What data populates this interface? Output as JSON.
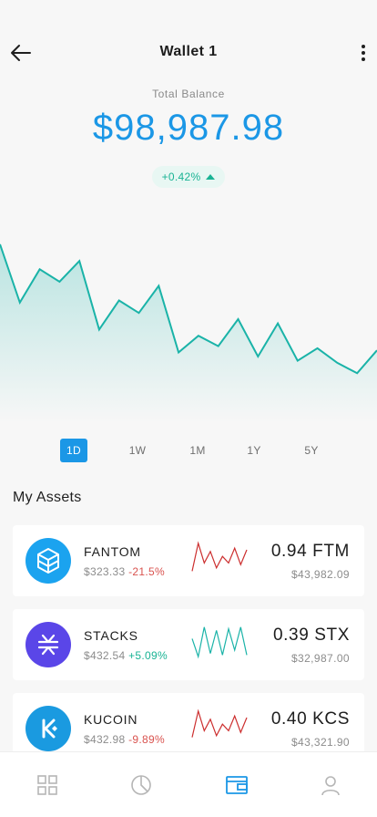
{
  "header": {
    "title": "Wallet 1",
    "back_icon": "arrow-left-icon",
    "menu_icon": "more-vertical-icon"
  },
  "balance": {
    "label": "Total Balance",
    "value": "$98,987.98",
    "change": "+0.42%",
    "change_direction": "up"
  },
  "chart_data": {
    "type": "area",
    "values": [
      98.6,
      95.8,
      97.4,
      96.8,
      97.8,
      94.5,
      95.9,
      95.3,
      96.6,
      93.4,
      94.2,
      93.7,
      95.0,
      93.2,
      94.8,
      93.0,
      93.6,
      92.9,
      92.4,
      93.5
    ],
    "ylim": [
      90,
      100
    ],
    "line_color": "#1ab3a8",
    "fill_color": "#d6f1ee"
  },
  "ranges": {
    "selected": "1D",
    "items": [
      {
        "label": "1D"
      },
      {
        "label": "1W"
      },
      {
        "label": "1M"
      },
      {
        "label": "1Y"
      },
      {
        "label": "5Y"
      }
    ]
  },
  "assets": {
    "title": "My Assets",
    "items": [
      {
        "name": "FANTOM",
        "price": "$323.33",
        "change": "-21.5%",
        "change_positive": false,
        "holding": "0.94 FTM",
        "holding_value": "$43,982.09",
        "icon": "fantom-logo-icon",
        "icon_color": "#1ba3ef",
        "spark_color": "#cc2e2e",
        "spark": [
          0.1,
          0.95,
          0.35,
          0.7,
          0.2,
          0.55,
          0.35,
          0.8,
          0.3,
          0.75
        ]
      },
      {
        "name": "STACKS",
        "price": "$432.54",
        "change": "+5.09%",
        "change_positive": true,
        "holding": "0.39 STX",
        "holding_value": "$32,987.00",
        "icon": "stacks-logo-icon",
        "icon_color": "#5a46e8",
        "spark_color": "#1ab3a8",
        "spark": [
          0.6,
          0.05,
          0.95,
          0.15,
          0.85,
          0.1,
          0.9,
          0.25,
          0.95,
          0.1
        ]
      },
      {
        "name": "KUCOIN",
        "price": "$432.98",
        "change": "-9.89%",
        "change_positive": false,
        "holding": "0.40 KCS",
        "holding_value": "$43,321.90",
        "icon": "kucoin-logo-icon",
        "icon_color": "#1a9ae0",
        "spark_color": "#cc2e2e",
        "spark": [
          0.15,
          0.95,
          0.35,
          0.7,
          0.2,
          0.55,
          0.35,
          0.8,
          0.3,
          0.75
        ]
      }
    ]
  },
  "tabbar": {
    "active": "wallet",
    "items": [
      {
        "icon": "grid-icon",
        "key": "dashboard"
      },
      {
        "icon": "pie-chart-icon",
        "key": "portfolio"
      },
      {
        "icon": "wallet-icon",
        "key": "wallet"
      },
      {
        "icon": "user-icon",
        "key": "profile"
      }
    ],
    "active_color": "#1b97e6",
    "inactive_color": "#b5b5b5"
  }
}
